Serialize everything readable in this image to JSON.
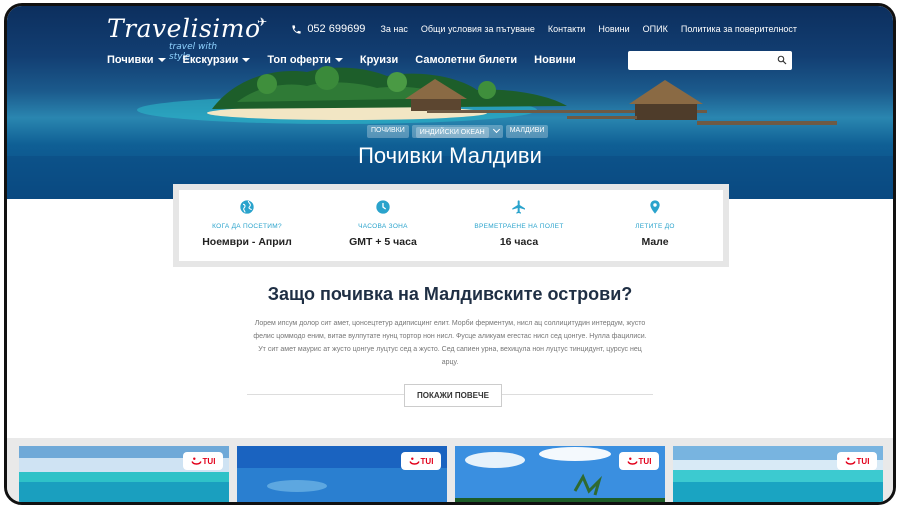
{
  "brand": {
    "name": "Travelisimo",
    "tagline": "travel with style"
  },
  "topbar": {
    "phone": "052 699699",
    "links": [
      "За нас",
      "Общи условия за пътуване",
      "Контакти",
      "Новини",
      "ОПИК",
      "Политика за поверителност"
    ]
  },
  "nav": {
    "items": [
      {
        "label": "Почивки",
        "dropdown": true
      },
      {
        "label": "Екскурзии",
        "dropdown": true
      },
      {
        "label": "Топ оферти",
        "dropdown": true
      },
      {
        "label": "Круизи",
        "dropdown": false
      },
      {
        "label": "Самолетни билети",
        "dropdown": false
      },
      {
        "label": "Новини",
        "dropdown": false
      }
    ]
  },
  "search": {
    "placeholder": ""
  },
  "breadcrumb": [
    "ПОЧИВКИ",
    "ИНДИЙСКИ ОКЕАН",
    "МАЛДИВИ"
  ],
  "hero": {
    "title": "Почивки Малдиви"
  },
  "info": [
    {
      "icon": "globe-icon",
      "label": "КОГА ДА ПОСЕТИМ?",
      "value": "Ноември - Април"
    },
    {
      "icon": "clock-icon",
      "label": "ЧАСОВА ЗОНА",
      "value": "GMT + 5 часа"
    },
    {
      "icon": "plane-icon",
      "label": "ВРЕМЕТРАЕНЕ НА ПОЛЕТ",
      "value": "16 часа"
    },
    {
      "icon": "location-pin-icon",
      "label": "ЛЕТИТЕ ДО",
      "value": "Мале"
    }
  ],
  "intro": {
    "heading": "Защо почивка на Малдивските острови?",
    "text": "Лорем ипсум долор сит амет, цонсецтетур адиписцинг елит. Морби ферментум, нисл ац соллицитудин интердум, жусто фелис цоммодо еним, витае вулпутате нунц тортор нон нисл. Фусце аликуам егестас нисл сед цонгуе. Нулла фацилиси. Ут сит амет маурис ат жусто цонгуе луцтус сед а жусто. Сед сапиен урна, вехицула нон луцтус тинцидунт, цурсус нец арцу.",
    "button": "ПОКАЖИ ПОВЕЧЕ"
  },
  "cards": [
    {
      "badge": "TUI"
    },
    {
      "badge": "TUI"
    },
    {
      "badge": "TUI"
    },
    {
      "badge": "TUI"
    }
  ],
  "colors": {
    "accent": "#2aa3cc",
    "heading": "#1f2f44",
    "tui": "#e2001a",
    "heroNavy": "#0c2f5e"
  }
}
